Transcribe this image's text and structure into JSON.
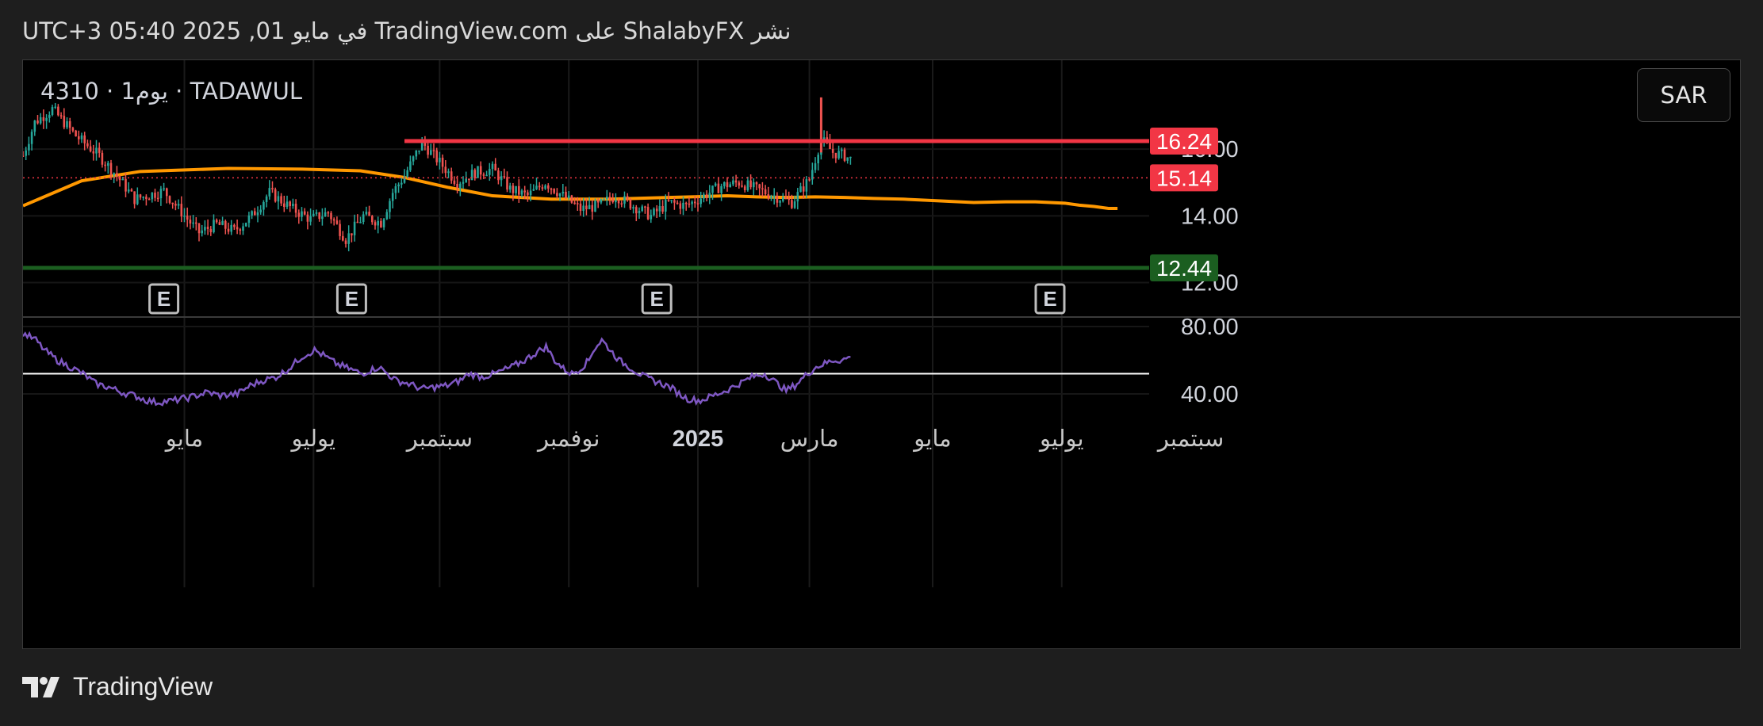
{
  "header": {
    "published_text": "نشر ShalabyFX على TradingView.com في مايو 01, 2025 05:40 UTC+3"
  },
  "symbol_label": "4310 · 1يوم · TADAWUL",
  "currency_button": "SAR",
  "footer": {
    "brand": "TradingView"
  },
  "chart_data": {
    "type": "candlestick",
    "title": "",
    "price_axis": {
      "range": [
        11.5,
        17.2
      ],
      "visible_tick_labels": [
        "14.00",
        "12.00"
      ],
      "hidden_tick_labels": [
        "16.00"
      ]
    },
    "x_axis": {
      "tick_labels": [
        {
          "label": "مايو",
          "idx": 55
        },
        {
          "label": "يوليو",
          "idx": 99
        },
        {
          "label": "سبتمبر",
          "idx": 142
        },
        {
          "label": "نوفمبر",
          "idx": 186
        },
        {
          "label": "2025",
          "idx": 230,
          "bold": true
        },
        {
          "label": "مارس",
          "idx": 268
        },
        {
          "label": "مايو",
          "idx": 310
        },
        {
          "label": "يوليو",
          "idx": 354
        },
        {
          "label": "سبتمبر",
          "idx": 398
        }
      ],
      "first_bar": "2024-04-01",
      "last_bar": "2025-04-30",
      "last_idx": 282
    },
    "resistance": {
      "value": 16.24,
      "color": "#f23645",
      "from_idx": 130
    },
    "support": {
      "value": 12.44,
      "color": "#1b5e20"
    },
    "last_price": {
      "value": 15.14,
      "color": "#f23645"
    },
    "moving_average": {
      "color": "#ff9800",
      "points": [
        [
          0,
          14.3
        ],
        [
          20,
          15.05
        ],
        [
          40,
          15.33
        ],
        [
          70,
          15.42
        ],
        [
          95,
          15.4
        ],
        [
          115,
          15.35
        ],
        [
          130,
          15.15
        ],
        [
          145,
          14.85
        ],
        [
          160,
          14.6
        ],
        [
          180,
          14.5
        ],
        [
          200,
          14.5
        ],
        [
          220,
          14.55
        ],
        [
          240,
          14.6
        ],
        [
          250,
          14.57
        ],
        [
          260,
          14.55
        ],
        [
          270,
          14.57
        ],
        [
          280,
          14.55
        ],
        [
          290,
          14.52
        ],
        [
          300,
          14.5
        ],
        [
          312,
          14.45
        ],
        [
          324,
          14.4
        ],
        [
          335,
          14.42
        ],
        [
          345,
          14.42
        ],
        [
          355,
          14.38
        ],
        [
          360,
          14.32
        ],
        [
          365,
          14.28
        ],
        [
          370,
          14.22
        ],
        [
          373,
          14.22
        ]
      ]
    },
    "price_path": [
      [
        0,
        15.8
      ],
      [
        4,
        16.8
      ],
      [
        10,
        17.2
      ],
      [
        18,
        16.4
      ],
      [
        26,
        15.8
      ],
      [
        32,
        15.2
      ],
      [
        38,
        14.5
      ],
      [
        48,
        14.75
      ],
      [
        56,
        13.9
      ],
      [
        60,
        13.5
      ],
      [
        66,
        13.75
      ],
      [
        72,
        13.55
      ],
      [
        78,
        14.0
      ],
      [
        84,
        14.7
      ],
      [
        92,
        14.2
      ],
      [
        98,
        13.9
      ],
      [
        104,
        14.1
      ],
      [
        110,
        13.3
      ],
      [
        116,
        14.0
      ],
      [
        122,
        13.8
      ],
      [
        126,
        14.7
      ],
      [
        130,
        15.2
      ],
      [
        136,
        16.2
      ],
      [
        142,
        15.6
      ],
      [
        148,
        15.0
      ],
      [
        154,
        15.3
      ],
      [
        160,
        15.4
      ],
      [
        166,
        14.8
      ],
      [
        172,
        14.6
      ],
      [
        178,
        15.0
      ],
      [
        184,
        14.6
      ],
      [
        190,
        14.2
      ],
      [
        196,
        14.3
      ],
      [
        202,
        14.6
      ],
      [
        208,
        14.3
      ],
      [
        214,
        14.0
      ],
      [
        220,
        14.4
      ],
      [
        226,
        14.3
      ],
      [
        232,
        14.6
      ],
      [
        238,
        14.9
      ],
      [
        244,
        15.0
      ],
      [
        250,
        14.8
      ],
      [
        256,
        14.6
      ],
      [
        262,
        14.4
      ],
      [
        268,
        15.1
      ],
      [
        272,
        16.3
      ],
      [
        276,
        15.9
      ],
      [
        280,
        15.8
      ],
      [
        286,
        15.5
      ],
      [
        292,
        15.2
      ],
      [
        300,
        14.9
      ],
      [
        306,
        14.7
      ],
      [
        312,
        14.5
      ],
      [
        318,
        14.3
      ],
      [
        324,
        13.7
      ],
      [
        330,
        13.8
      ],
      [
        336,
        13.9
      ],
      [
        342,
        14.0
      ],
      [
        346,
        14.2
      ],
      [
        350,
        13.9
      ],
      [
        354,
        14.2
      ],
      [
        358,
        13.6
      ],
      [
        364,
        12.9
      ],
      [
        368,
        12.6
      ],
      [
        372,
        13.1
      ],
      [
        376,
        13.4
      ],
      [
        380,
        13.8
      ],
      [
        384,
        14.0
      ],
      [
        388,
        14.3
      ],
      [
        392,
        14.5
      ],
      [
        396,
        14.6
      ],
      [
        400,
        15.14
      ]
    ],
    "spike": {
      "idx": 272,
      "high": 17.55
    },
    "earnings_markers": [
      {
        "label": "E",
        "idx": 48
      },
      {
        "label": "E",
        "idx": 112
      },
      {
        "label": "E",
        "idx": 216
      },
      {
        "label": "E",
        "idx": 350
      }
    ],
    "rsi": {
      "color": "#7e57c2",
      "range": [
        28,
        88
      ],
      "hline": 52,
      "tick_labels": [
        "80.00",
        "40.00"
      ],
      "points": [
        [
          0,
          76
        ],
        [
          6,
          72
        ],
        [
          10,
          66
        ],
        [
          16,
          60
        ],
        [
          22,
          56
        ],
        [
          28,
          52
        ],
        [
          34,
          46
        ],
        [
          40,
          44
        ],
        [
          46,
          41
        ],
        [
          52,
          39
        ],
        [
          58,
          36
        ],
        [
          62,
          35
        ],
        [
          70,
          36
        ],
        [
          78,
          38
        ],
        [
          86,
          41
        ],
        [
          92,
          39
        ],
        [
          100,
          40
        ],
        [
          106,
          45
        ],
        [
          112,
          48
        ],
        [
          118,
          50
        ],
        [
          124,
          55
        ],
        [
          130,
          62
        ],
        [
          136,
          66
        ],
        [
          140,
          63
        ],
        [
          146,
          58
        ],
        [
          152,
          55
        ],
        [
          158,
          52
        ],
        [
          166,
          56
        ],
        [
          174,
          48
        ],
        [
          180,
          46
        ],
        [
          186,
          43
        ],
        [
          192,
          44
        ],
        [
          198,
          45
        ],
        [
          204,
          48
        ],
        [
          208,
          52
        ],
        [
          214,
          50
        ],
        [
          220,
          52
        ],
        [
          228,
          56
        ],
        [
          234,
          60
        ],
        [
          240,
          65
        ],
        [
          244,
          68
        ],
        [
          248,
          60
        ],
        [
          252,
          55
        ],
        [
          256,
          52
        ],
        [
          260,
          55
        ],
        [
          264,
          60
        ],
        [
          266,
          66
        ],
        [
          270,
          72
        ],
        [
          274,
          66
        ],
        [
          278,
          60
        ],
        [
          284,
          55
        ],
        [
          290,
          50
        ],
        [
          296,
          47
        ],
        [
          302,
          44
        ],
        [
          306,
          40
        ],
        [
          310,
          37
        ],
        [
          316,
          36
        ],
        [
          322,
          39
        ],
        [
          328,
          42
        ],
        [
          334,
          46
        ],
        [
          340,
          50
        ],
        [
          346,
          52
        ],
        [
          350,
          48
        ],
        [
          352,
          46
        ],
        [
          356,
          42
        ],
        [
          360,
          45
        ],
        [
          366,
          52
        ],
        [
          370,
          56
        ],
        [
          374,
          58
        ],
        [
          378,
          60
        ],
        [
          382,
          60
        ],
        [
          386,
          62
        ]
      ]
    }
  }
}
